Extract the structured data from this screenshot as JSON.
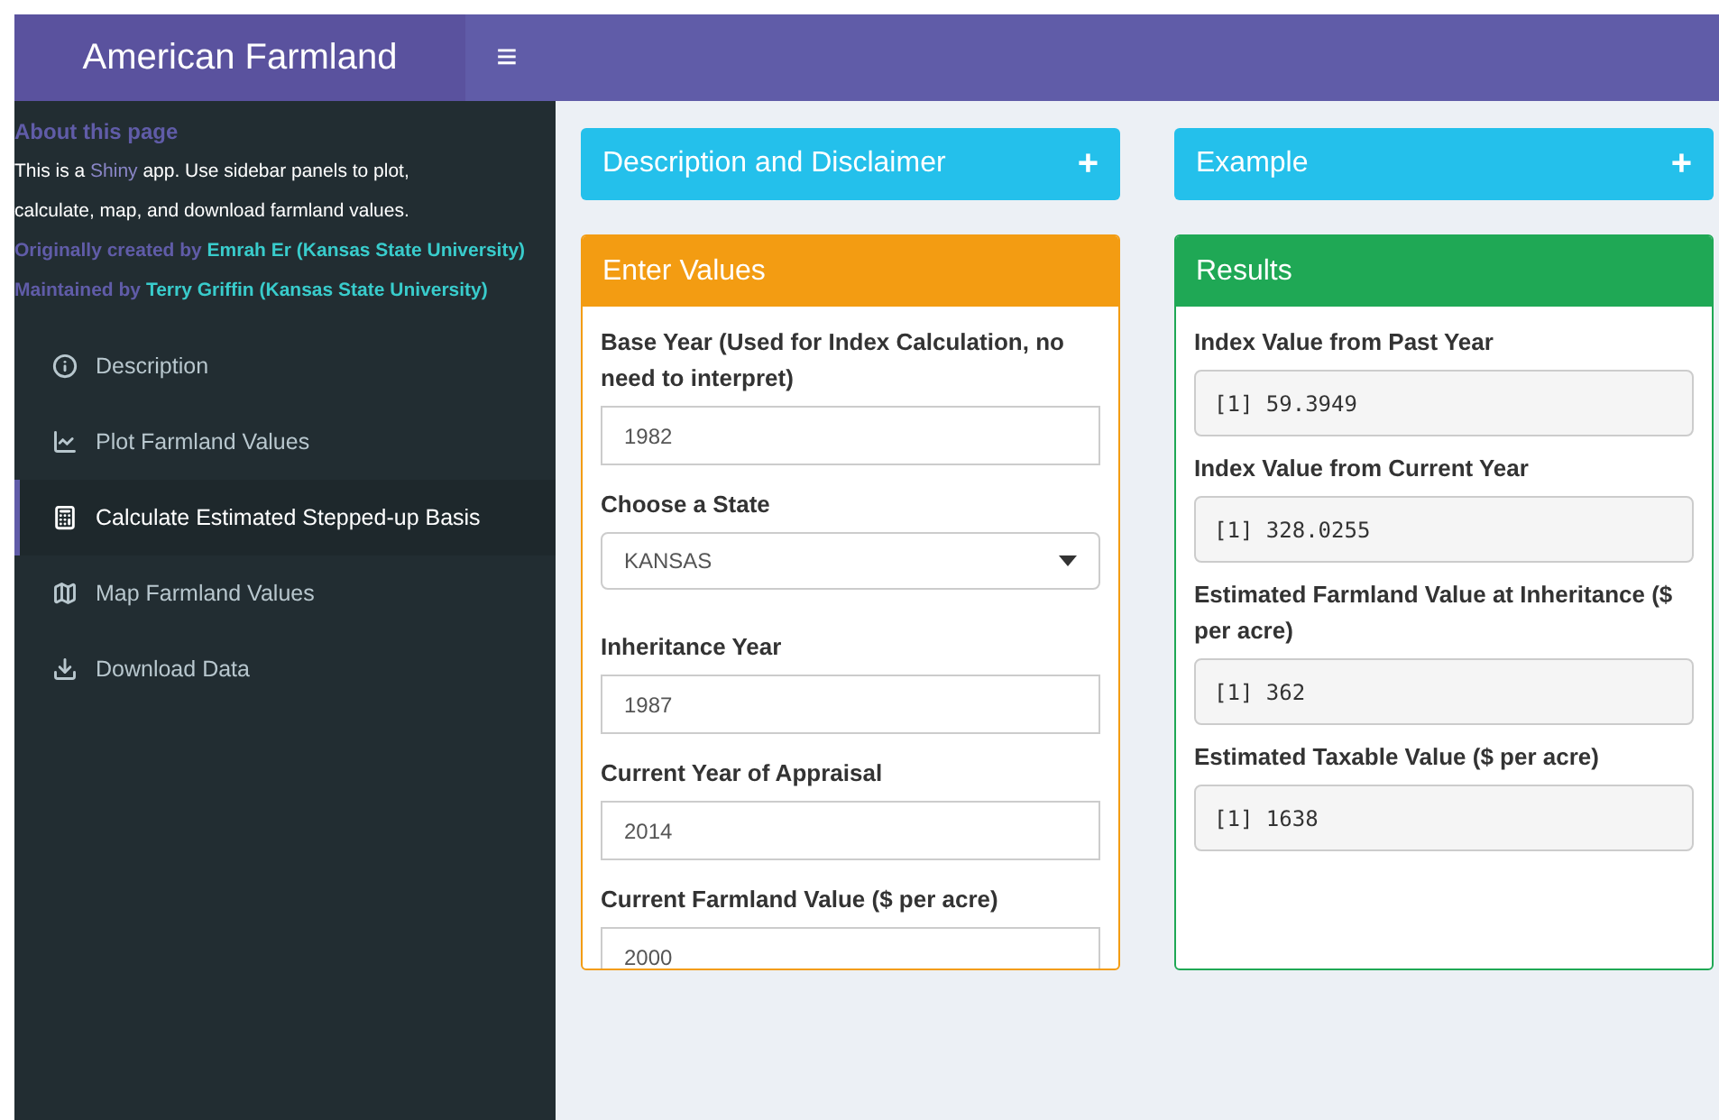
{
  "header": {
    "title": "American Farmland",
    "menu_icon": "≡"
  },
  "sidebar": {
    "about_title": "About this page",
    "intro": {
      "before": "This is a ",
      "link": "Shiny",
      "after": " app. Use sidebar panels to plot, calculate, map, and download farmland values."
    },
    "credits": [
      {
        "prefix": "Originally created by",
        "name": "Emrah Er (Kansas State University)"
      },
      {
        "prefix": "Maintained by",
        "name": "Terry Griffin (Kansas State University)"
      }
    ],
    "items": [
      {
        "kind": "info",
        "label": "Description",
        "selected": false
      },
      {
        "kind": "chart",
        "label": "Plot Farmland Values",
        "selected": false
      },
      {
        "kind": "calculator",
        "label": "Calculate Estimated Stepped-up Basis",
        "selected": true
      },
      {
        "kind": "map",
        "label": "Map Farmland Values",
        "selected": false
      },
      {
        "kind": "download",
        "label": "Download Data",
        "selected": false
      }
    ]
  },
  "columns": [
    {
      "collapsed_box": {
        "title": "Description and Disclaimer",
        "expand_icon": "+"
      },
      "box": {
        "kind": "inputs",
        "title": "Enter Values",
        "fields": [
          {
            "kind": "text",
            "label": "Base Year (Used for Index Calculation, no need to interpret)",
            "value": "1982"
          },
          {
            "kind": "select",
            "label": "Choose a State",
            "value": "KANSAS"
          },
          {
            "kind": "text",
            "label": "Inheritance Year",
            "value": "1987"
          },
          {
            "kind": "text",
            "label": "Current Year of Appraisal",
            "value": "2014"
          },
          {
            "kind": "text",
            "label": "Current Farmland Value ($ per acre)",
            "value": "2000"
          }
        ]
      }
    },
    {
      "collapsed_box": {
        "title": "Example",
        "expand_icon": "+"
      },
      "box": {
        "kind": "results",
        "title": "Results",
        "fields": [
          {
            "kind": "output",
            "label": "Index Value from Past Year",
            "value": "[1] 59.3949"
          },
          {
            "kind": "output",
            "label": "Index Value from Current Year",
            "value": "[1] 328.0255"
          },
          {
            "kind": "output",
            "label": "Estimated Farmland Value at Inheritance ($ per acre)",
            "value": "[1] 362"
          },
          {
            "kind": "output",
            "label": "Estimated Taxable Value ($ per acre)",
            "value": "[1] 1638"
          }
        ]
      }
    }
  ]
}
